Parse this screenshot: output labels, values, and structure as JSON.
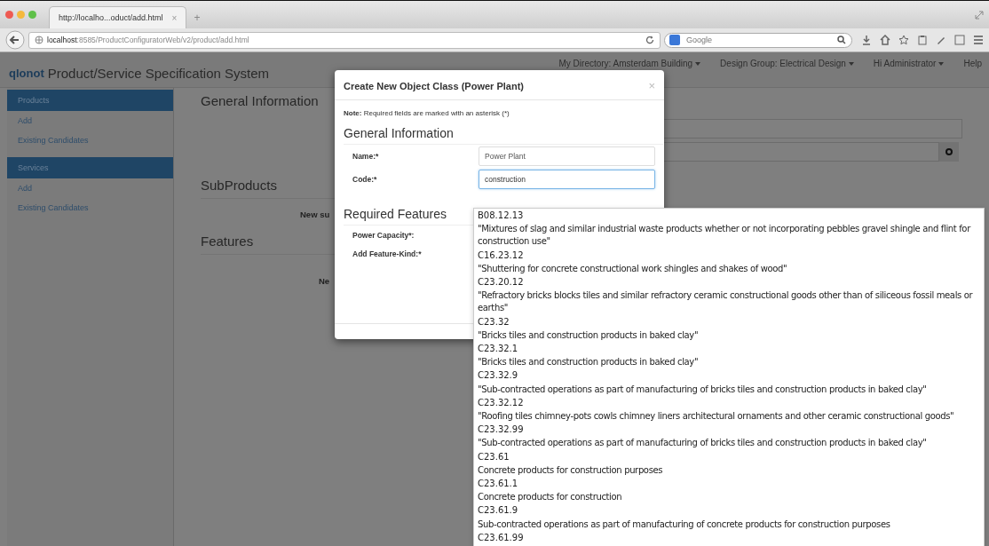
{
  "browser": {
    "tab": {
      "title": "http://localho...oduct/add.html",
      "close": "×"
    },
    "new_tab": "+",
    "url": "**localhost**:8585/ProductConfiguratorWeb/v2/product/add.html",
    "search": {
      "placeholder": "Google"
    }
  },
  "navbar": {
    "logo": "qlonot",
    "title": "Product/Service Specification System",
    "menus": [
      {
        "label": "My Directory: Amsterdam Building",
        "dropdown": true
      },
      {
        "label": "Design Group: Electrical Design",
        "dropdown": true
      },
      {
        "label": "Hi Administrator",
        "dropdown": true
      },
      {
        "label": "Help",
        "dropdown": false
      }
    ]
  },
  "sidebar": {
    "sections": [
      {
        "title": "Products",
        "items": [
          "Add",
          "Existing Candidates"
        ]
      },
      {
        "title": "Services",
        "items": [
          "Add",
          "Existing Candidates"
        ]
      }
    ]
  },
  "main": {
    "sections": [
      {
        "title": "General Information"
      },
      {
        "title": "SubProducts",
        "note": "New su"
      },
      {
        "title": "Features",
        "note": "Ne"
      }
    ]
  },
  "modal": {
    "title": "Create New Object Class (Power Plant)",
    "close": "×",
    "note": "**Note:** Required fields are marked with an asterisk (*)",
    "general_heading": "General Information",
    "fields": [
      {
        "label": "Name:*",
        "value": "Power Plant",
        "focused": false
      },
      {
        "label": "Code:*",
        "value": "construction",
        "focused": true
      }
    ],
    "features_heading": "Required Features",
    "feature_labels": [
      "Power Capacity*:",
      "Add Feature-Kind:*"
    ]
  },
  "suggestions": [
    {
      "code": "B08.12.13",
      "description": "\"Mixtures of slag and similar industrial waste products whether or not incorporating pebbles gravel shingle and flint for construction use\""
    },
    {
      "code": "C16.23.12",
      "description": "\"Shuttering for concrete constructional work shingles and shakes of wood\""
    },
    {
      "code": "C23.20.12",
      "description": "\"Refractory bricks blocks tiles and similar refractory ceramic constructional goods other than of siliceous fossil meals or earths\""
    },
    {
      "code": "C23.32",
      "description": "\"Bricks tiles and construction products in baked clay\""
    },
    {
      "code": "C23.32.1",
      "description": "\"Bricks tiles and construction products in baked clay\""
    },
    {
      "code": "C23.32.9",
      "description": "\"Sub-contracted operations as part of manufacturing of bricks tiles and construction products in baked clay\""
    },
    {
      "code": "C23.32.12",
      "description": "\"Roofing tiles chimney-pots cowls chimney liners architectural ornaments and other ceramic constructional goods\""
    },
    {
      "code": "C23.32.99",
      "description": "\"Sub-contracted operations as part of manufacturing of bricks tiles and construction products in baked clay\""
    },
    {
      "code": "C23.61",
      "description": "Concrete products for construction purposes"
    },
    {
      "code": "C23.61.1",
      "description": "Concrete products for construction"
    },
    {
      "code": "C23.61.9",
      "description": "Sub-contracted operations as part of manufacturing of concrete products for construction purposes"
    },
    {
      "code": "C23.61.99"
    }
  ]
}
